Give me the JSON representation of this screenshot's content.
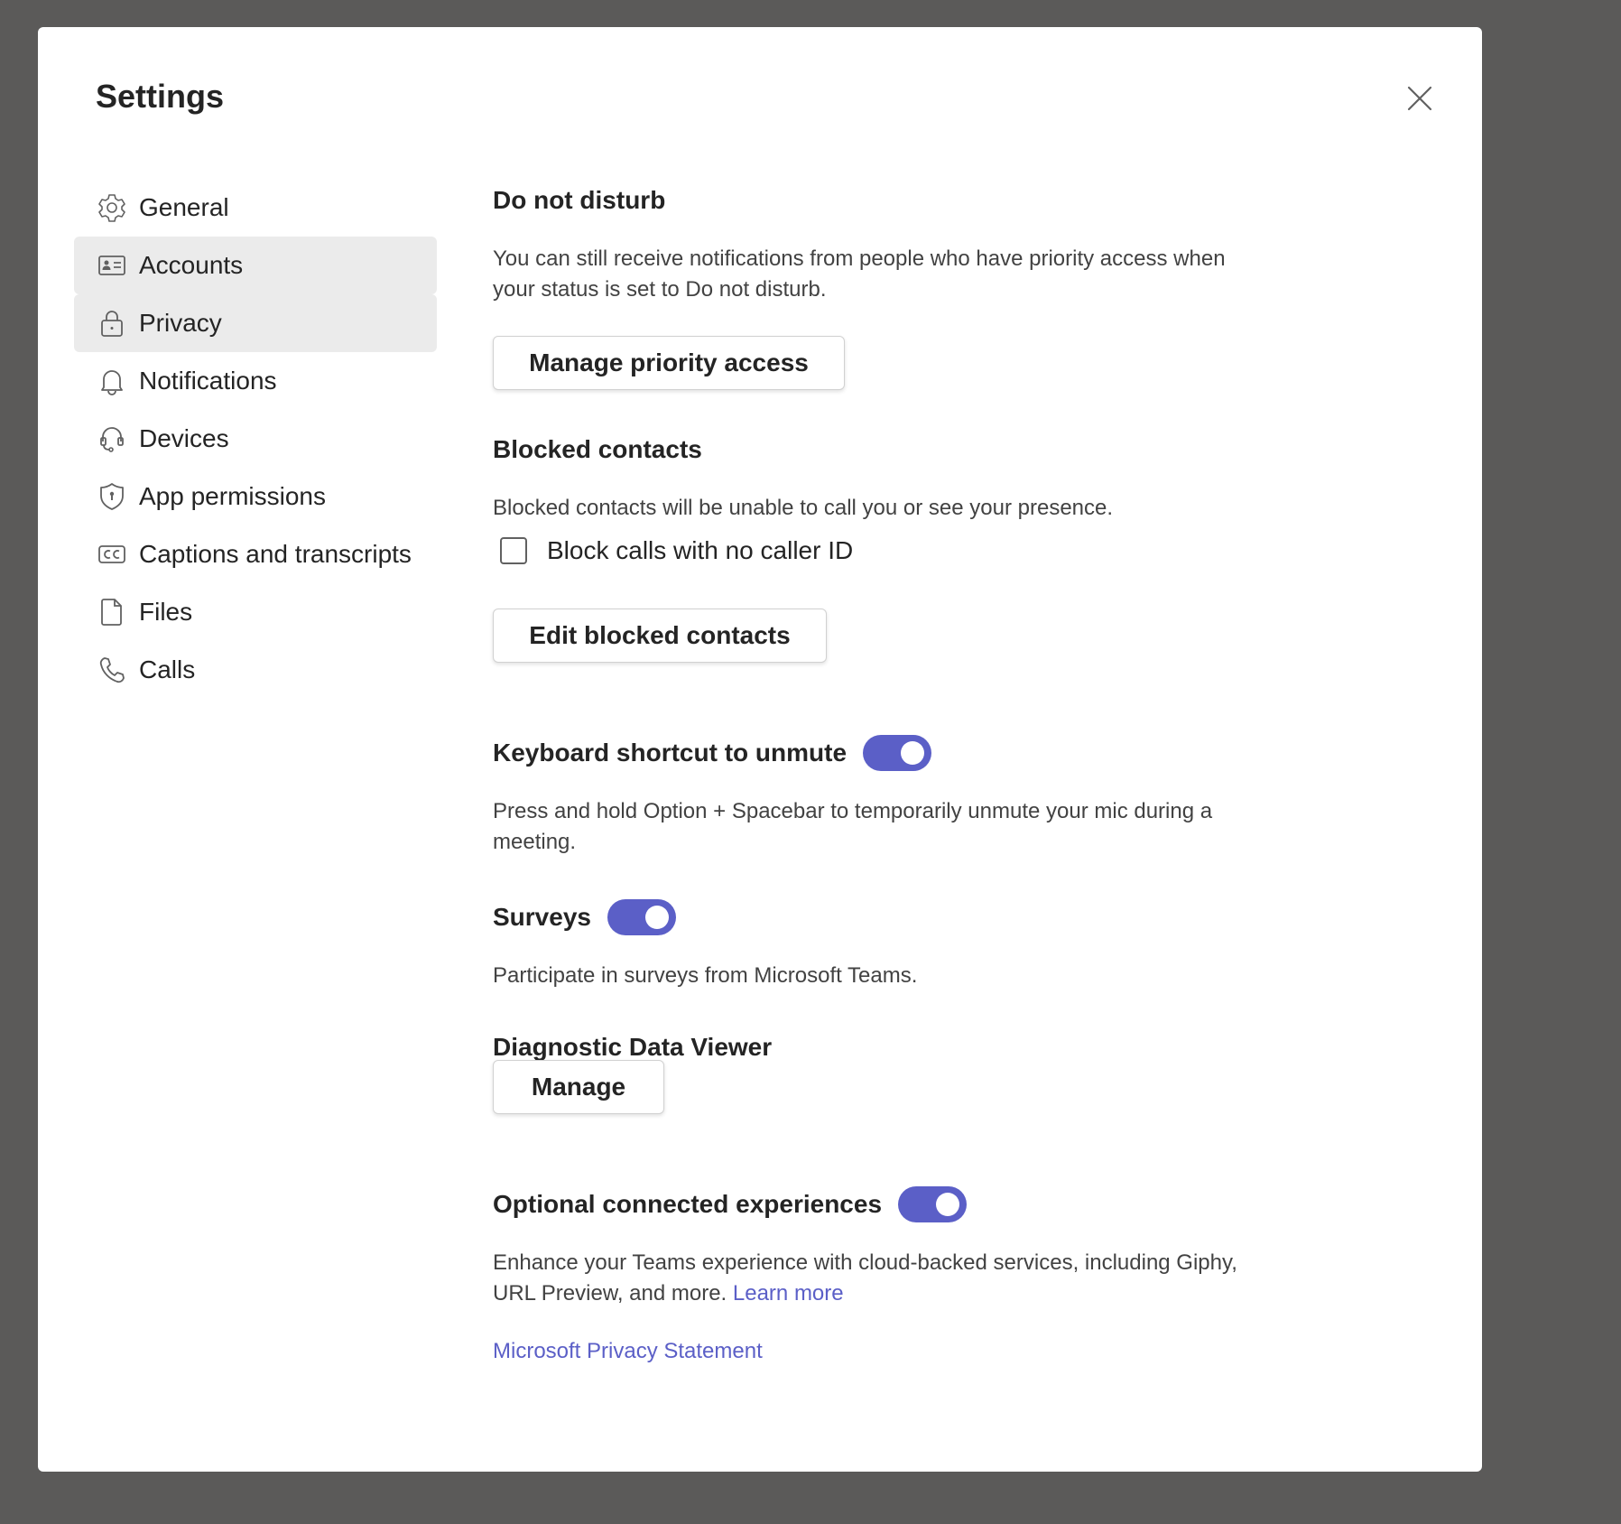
{
  "dialog": {
    "title": "Settings",
    "close_icon": "close-icon"
  },
  "sidebar": {
    "items": [
      {
        "label": "General",
        "icon": "gear-icon",
        "highlighted": false
      },
      {
        "label": "Accounts",
        "icon": "id-card-icon",
        "highlighted": true
      },
      {
        "label": "Privacy",
        "icon": "lock-icon",
        "highlighted": true
      },
      {
        "label": "Notifications",
        "icon": "bell-icon",
        "highlighted": false
      },
      {
        "label": "Devices",
        "icon": "headset-icon",
        "highlighted": false
      },
      {
        "label": "App permissions",
        "icon": "shield-icon",
        "highlighted": false
      },
      {
        "label": "Captions and transcripts",
        "icon": "closed-captions-icon",
        "highlighted": false
      },
      {
        "label": "Files",
        "icon": "document-icon",
        "highlighted": false
      },
      {
        "label": "Calls",
        "icon": "phone-icon",
        "highlighted": false
      }
    ]
  },
  "privacy": {
    "dnd": {
      "heading": "Do not disturb",
      "description": "You can still receive notifications from people who have priority access when your status is set to Do not disturb.",
      "button": "Manage priority access"
    },
    "blocked": {
      "heading": "Blocked contacts",
      "description": "Blocked contacts will be unable to call you or see your presence.",
      "checkbox_label": "Block calls with no caller ID",
      "checkbox_checked": false,
      "button": "Edit blocked contacts"
    },
    "shortcut": {
      "heading": "Keyboard shortcut to unmute",
      "enabled": true,
      "description": "Press and hold Option + Spacebar to temporarily unmute your mic during a meeting."
    },
    "surveys": {
      "heading": "Surveys",
      "enabled": true,
      "description": "Participate in surveys from Microsoft Teams."
    },
    "diagnostic": {
      "heading": "Diagnostic Data Viewer",
      "button": "Manage"
    },
    "connected": {
      "heading": "Optional connected experiences",
      "enabled": true,
      "description": "Enhance your Teams experience with cloud-backed services, including Giphy, URL Preview, and more.",
      "learn_more": "Learn more"
    },
    "privacy_statement_link": "Microsoft Privacy Statement"
  },
  "colors": {
    "accent": "#5b5fc7",
    "backdrop": "#5b5a59",
    "selected_nav_bg": "#ebebeb"
  }
}
